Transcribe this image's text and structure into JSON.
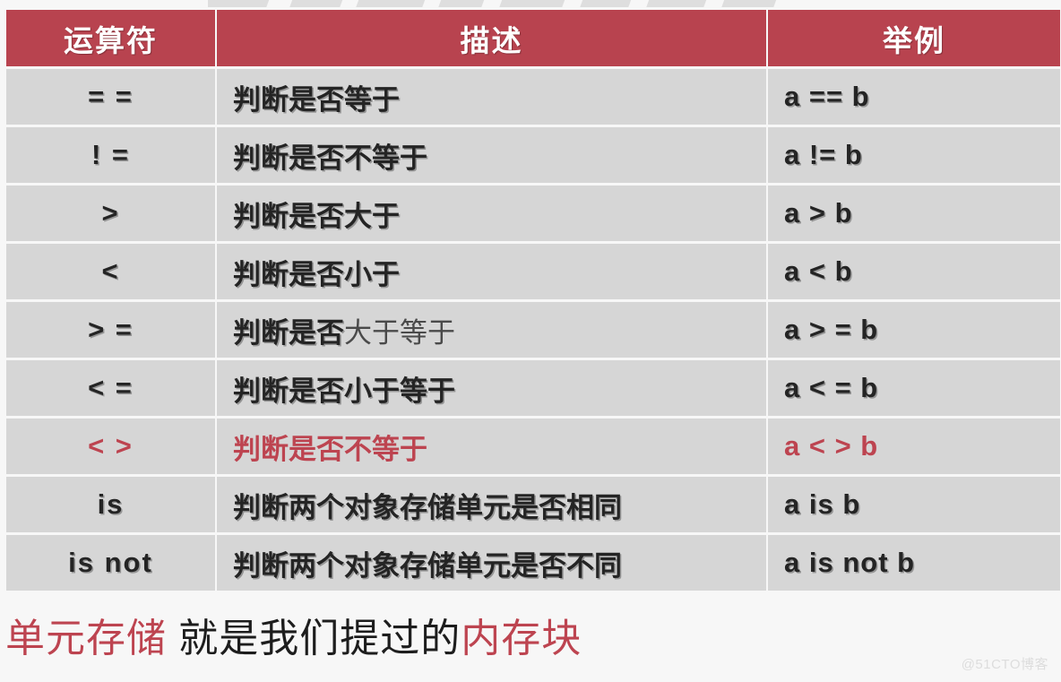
{
  "table": {
    "headers": [
      "运算符",
      "描述",
      "举例"
    ],
    "rows": [
      {
        "op": "= =",
        "desc": "判断是否等于",
        "desc_dim": "",
        "example": "a == b",
        "accent": false
      },
      {
        "op": "!  =",
        "desc": "判断是否不等于",
        "desc_dim": "",
        "example": "a != b",
        "accent": false
      },
      {
        "op": ">",
        "desc": "判断是否大于",
        "desc_dim": "",
        "example": "a > b",
        "accent": false
      },
      {
        "op": "<",
        "desc": "判断是否小于",
        "desc_dim": "",
        "example": "a < b",
        "accent": false
      },
      {
        "op": "> =",
        "desc": "判断是否",
        "desc_dim": "大于等于",
        "example": "a > = b",
        "accent": false
      },
      {
        "op": "< =",
        "desc": "判断是否小于等于",
        "desc_dim": "",
        "example": "a < = b",
        "accent": false
      },
      {
        "op": "< >",
        "desc": "判断是否不等于",
        "desc_dim": "",
        "example": "a < > b",
        "accent": true
      },
      {
        "op": "is",
        "desc": "判断两个对象存储单元是否相同",
        "desc_dim": "",
        "example": "a is b",
        "accent": false
      },
      {
        "op": "is not",
        "desc": "判断两个对象存储单元是否不同",
        "desc_dim": "",
        "example": "a is not b",
        "accent": false
      }
    ]
  },
  "caption": {
    "part1": "单元存储",
    "part2": " 就是我们提过的",
    "part3": "内存块"
  },
  "watermark": "@51CTO博客",
  "colors": {
    "header_red": "#b8434f",
    "accent_red": "#bd4450",
    "row_gray": "#d6d6d6",
    "page_bg": "#f7f7f7",
    "text_dark": "#242424"
  }
}
